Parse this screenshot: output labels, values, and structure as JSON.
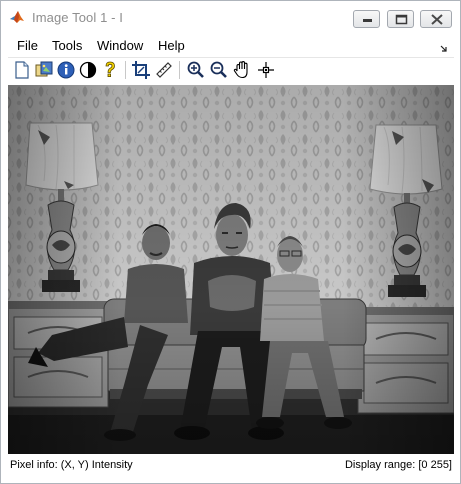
{
  "window": {
    "title": "Image Tool 1 - I",
    "icon": "matlab-logo-icon"
  },
  "menubar": {
    "items": [
      "File",
      "Tools",
      "Window",
      "Help"
    ]
  },
  "toolbar": {
    "buttons": [
      "new-figure-icon",
      "export-image-icon",
      "image-info-icon",
      "adjust-contrast-icon",
      "help-icon",
      "crop-icon",
      "measure-distance-icon",
      "zoom-in-icon",
      "zoom-out-icon",
      "pan-icon",
      "pixel-region-icon"
    ]
  },
  "statusbar": {
    "pixel_info": "Pixel info: (X, Y)  Intensity",
    "display_range": "Display range: [0 255]"
  },
  "colors": {
    "title_text": "#8e8e8e",
    "window_border": "#aeb4bb",
    "close_button_x": "#4a4a4a"
  }
}
